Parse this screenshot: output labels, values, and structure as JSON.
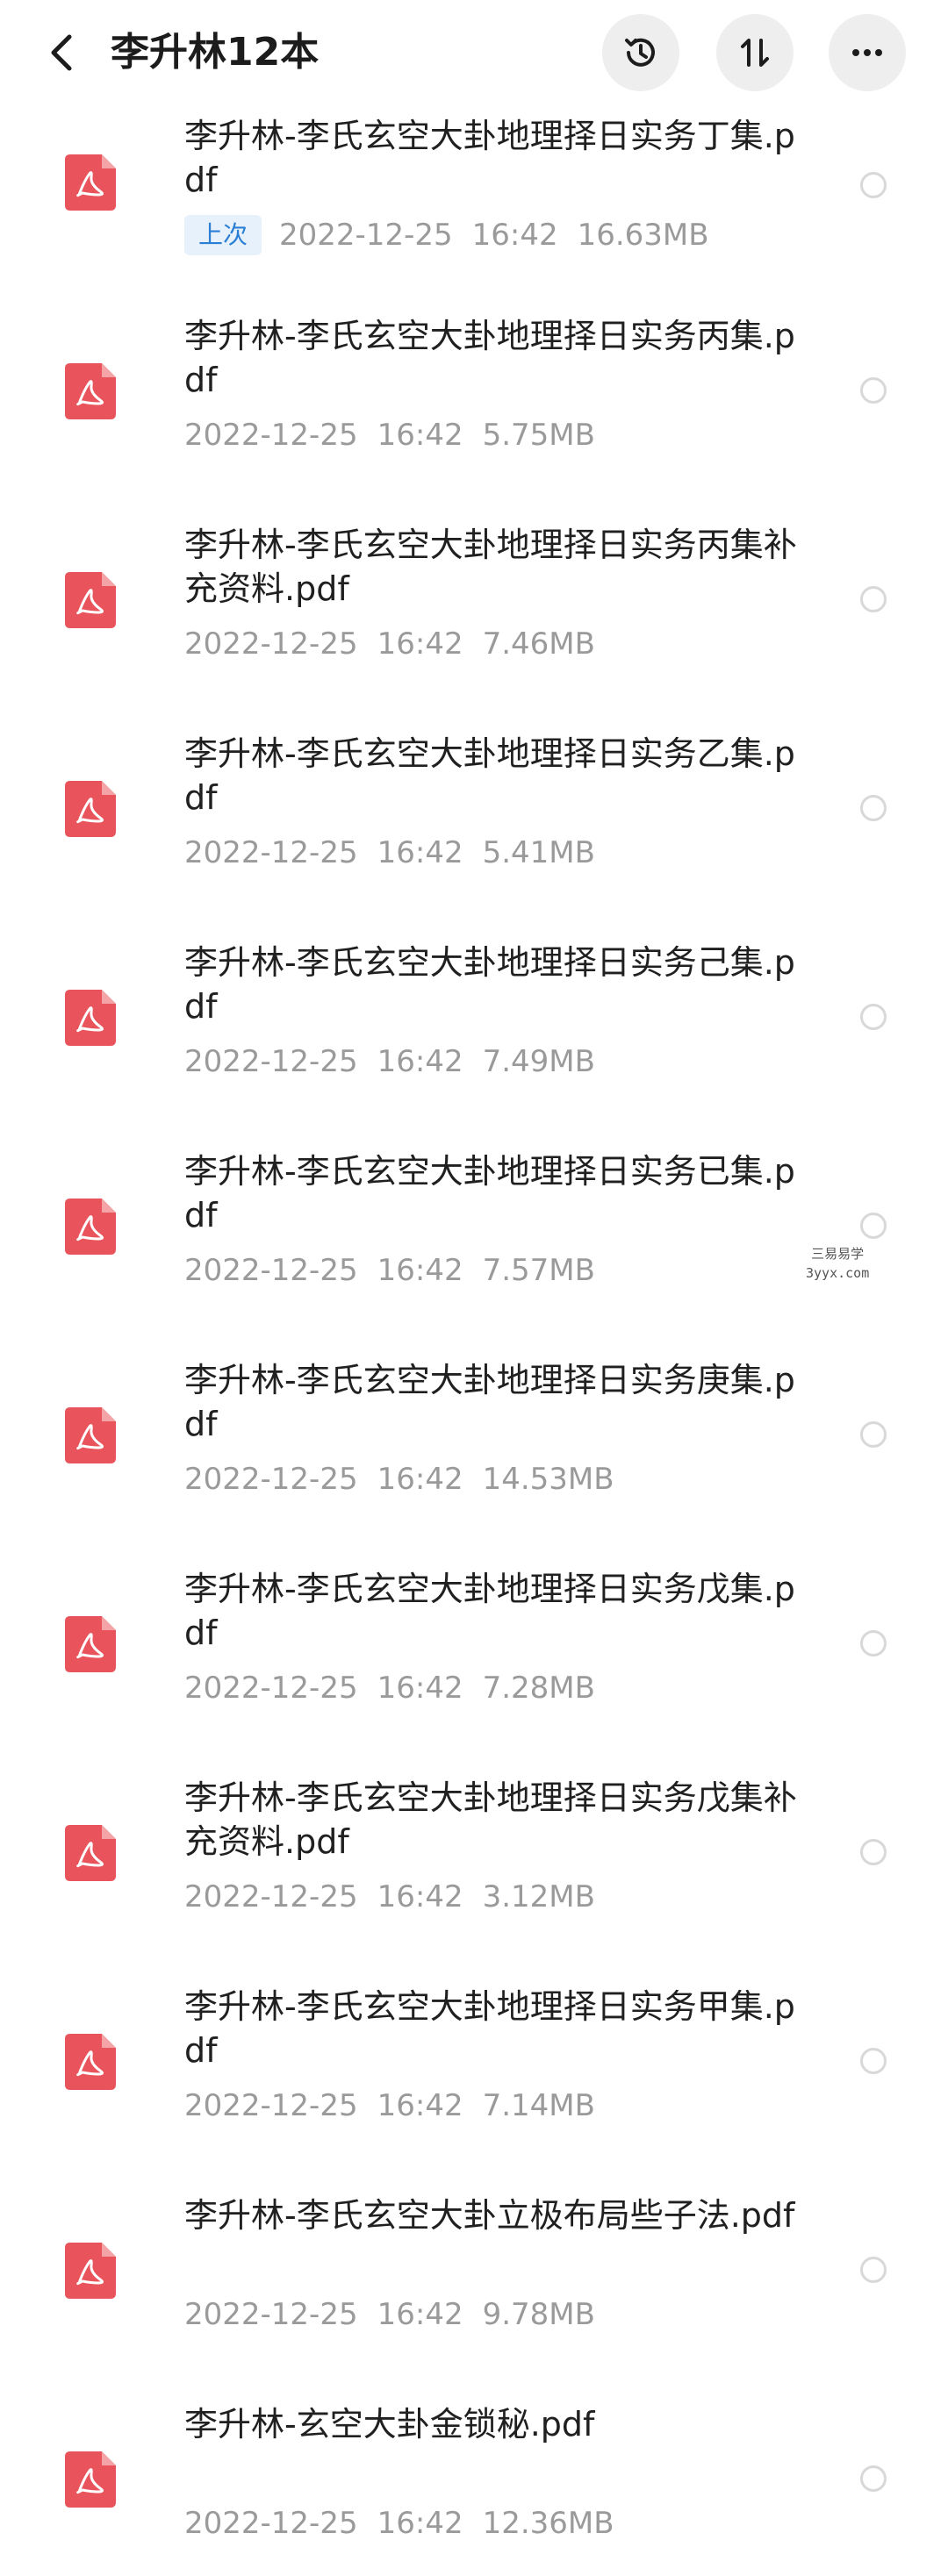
{
  "header": {
    "title": "李升林12本",
    "back_icon": "chevron-left-icon",
    "history_icon": "history-icon",
    "sort_icon": "sort-icon",
    "more_icon": "more-icon"
  },
  "colors": {
    "pdf_icon": "#e9535b",
    "badge_text": "#2a7fd4",
    "badge_bg": "#e7f1fb",
    "meta_text": "#9a9a9a"
  },
  "files": [
    {
      "name": "李升林-李氏玄空大卦地理择日实务丁集.pdf",
      "badge": "上次",
      "date": "2022-12-25",
      "time": "16:42",
      "size": "16.63MB"
    },
    {
      "name": "李升林-李氏玄空大卦地理择日实务丙集.pdf",
      "date": "2022-12-25",
      "time": "16:42",
      "size": "5.75MB"
    },
    {
      "name": "李升林-李氏玄空大卦地理择日实务丙集补充资料.pdf",
      "date": "2022-12-25",
      "time": "16:42",
      "size": "7.46MB"
    },
    {
      "name": "李升林-李氏玄空大卦地理择日实务乙集.pdf",
      "date": "2022-12-25",
      "time": "16:42",
      "size": "5.41MB"
    },
    {
      "name": "李升林-李氏玄空大卦地理择日实务己集.pdf",
      "date": "2022-12-25",
      "time": "16:42",
      "size": "7.49MB"
    },
    {
      "name": "李升林-李氏玄空大卦地理择日实务已集.pdf",
      "date": "2022-12-25",
      "time": "16:42",
      "size": "7.57MB"
    },
    {
      "name": "李升林-李氏玄空大卦地理择日实务庚集.pdf",
      "date": "2022-12-25",
      "time": "16:42",
      "size": "14.53MB"
    },
    {
      "name": "李升林-李氏玄空大卦地理择日实务戊集.pdf",
      "date": "2022-12-25",
      "time": "16:42",
      "size": "7.28MB"
    },
    {
      "name": "李升林-李氏玄空大卦地理择日实务戊集补充资料.pdf",
      "date": "2022-12-25",
      "time": "16:42",
      "size": "3.12MB"
    },
    {
      "name": "李升林-李氏玄空大卦地理择日实务甲集.pdf",
      "date": "2022-12-25",
      "time": "16:42",
      "size": "7.14MB"
    },
    {
      "name": "李升林-李氏玄空大卦立极布局些子法.pdf",
      "date": "2022-12-25",
      "time": "16:42",
      "size": "9.78MB"
    },
    {
      "name": "李升林-玄空大卦金锁秘.pdf",
      "date": "2022-12-25",
      "time": "16:42",
      "size": "12.36MB"
    }
  ],
  "watermark": {
    "line1": "三易易学",
    "line2": "3yyx.com"
  }
}
